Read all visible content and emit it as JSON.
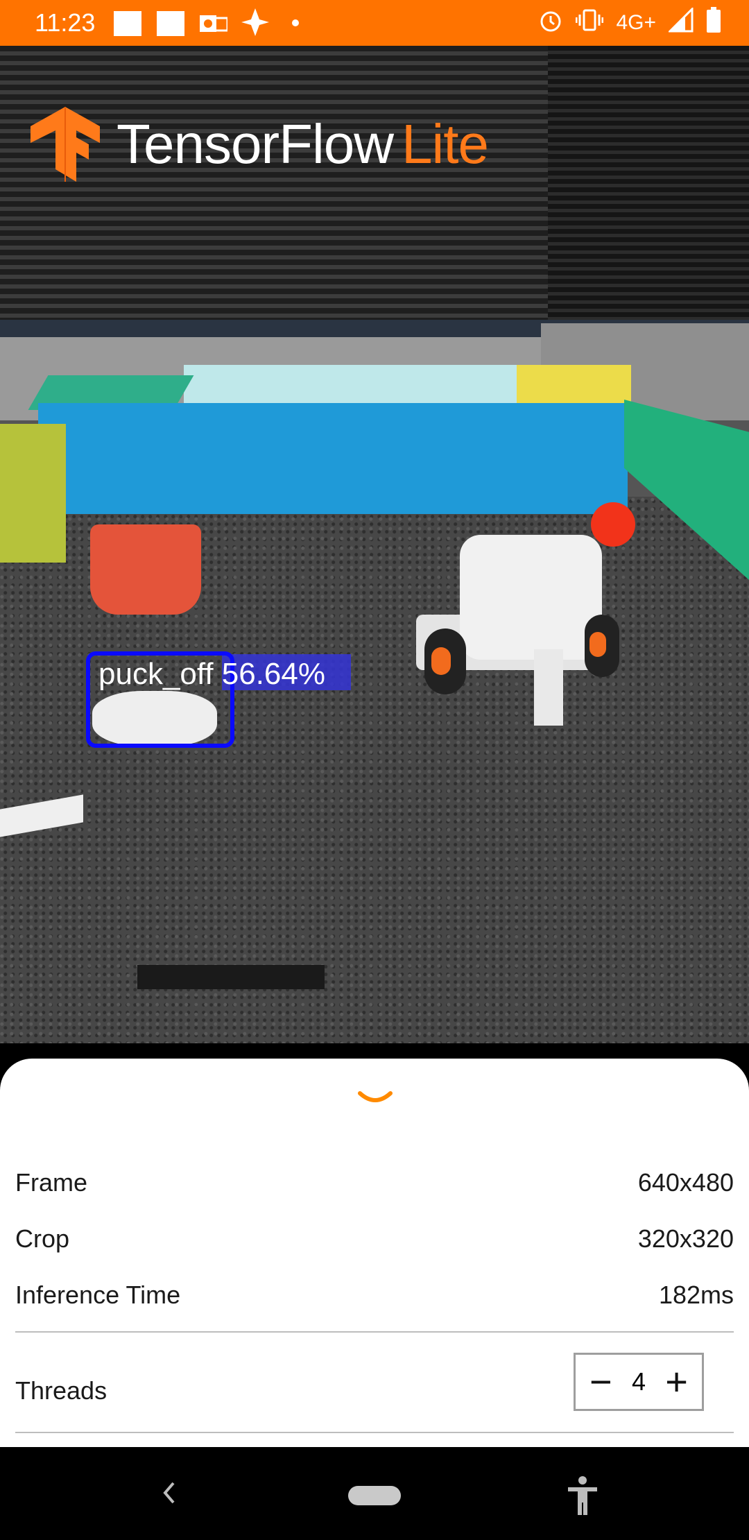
{
  "status_bar": {
    "time": "11:23",
    "icons_left": [
      "image-icon",
      "image-icon",
      "outlook-icon",
      "pinwheel-icon",
      "dot-icon"
    ],
    "icons_right": [
      "alarm-icon",
      "vibrate-icon",
      "network-type",
      "signal-icon",
      "battery-icon"
    ],
    "network_type": "4G+",
    "color": "#ff7300"
  },
  "logo": {
    "word1": "TensorFlow",
    "word2": "Lite",
    "accent_color": "#ff7a1a"
  },
  "detection": {
    "label": "puck_off 56.64%",
    "box_color": "#0a0aff"
  },
  "sheet": {
    "collapse_icon": "chevron-down-icon",
    "rows": [
      {
        "label": "Frame",
        "value": "640x480"
      },
      {
        "label": "Crop",
        "value": "320x320"
      },
      {
        "label": "Inference Time",
        "value": "182ms"
      }
    ],
    "threads": {
      "label": "Threads",
      "value": "4",
      "minus": "−",
      "plus": "+"
    }
  },
  "navbar": {
    "icons": [
      "back-icon",
      "home-pill",
      "accessibility-icon"
    ]
  }
}
